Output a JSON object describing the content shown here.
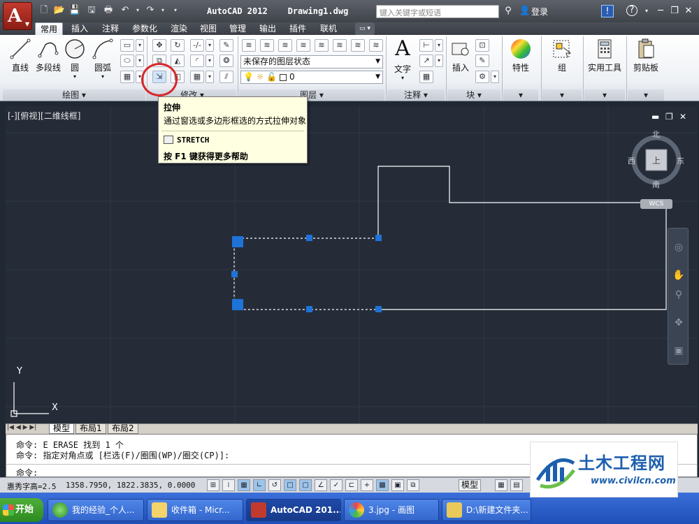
{
  "titlebar": {
    "title": "AutoCAD 2012    Drawing1.dwg",
    "search_placeholder": "键入关键字或短语",
    "login": "登录"
  },
  "tabs": [
    "常用",
    "插入",
    "注释",
    "参数化",
    "渲染",
    "视图",
    "管理",
    "输出",
    "插件",
    "联机"
  ],
  "ribbon": {
    "draw": {
      "line": "直线",
      "polyline": "多段线",
      "circle": "圆",
      "arc": "圆弧",
      "panel": "绘图"
    },
    "modify": {
      "panel": "修改"
    },
    "layers": {
      "state": "未保存的图层状态",
      "current": "0",
      "panel": "图层"
    },
    "annotation": {
      "text": "文字",
      "panel": "注释"
    },
    "block": {
      "insert": "插入",
      "panel": "块"
    },
    "properties": {
      "label": "特性"
    },
    "groups": {
      "label": "组"
    },
    "utilities": {
      "label": "实用工具"
    },
    "clipboard": {
      "label": "剪贴板"
    }
  },
  "tooltip": {
    "title": "拉伸",
    "description": "通过窗选或多边形框选的方式拉伸对象",
    "command": "STRETCH",
    "help": "按 F1 键获得更多帮助"
  },
  "viewport": {
    "label": "[-][俯视][二维线框]",
    "compass": {
      "north": "北",
      "south": "南",
      "east": "东",
      "west": "西",
      "top": "上",
      "wcs": "WCS"
    },
    "ucs": {
      "x": "X",
      "y": "Y"
    }
  },
  "layout_tabs": [
    "模型",
    "布局1",
    "布局2"
  ],
  "command_line": {
    "line1": "命令: E ERASE 找到 1 个",
    "line2": "命令: 指定对角点或 [栏选(F)/圈围(WP)/圈交(CP)]:",
    "prompt": "命令:"
  },
  "status": {
    "text_height": "惠秀字高=2.5",
    "coords": "1358.7950, 1822.3835, 0.0000",
    "model": "模型"
  },
  "taskbar": {
    "start": "开始",
    "tasks": [
      "我的经验_个人...",
      "收件箱 - Micr...",
      "AutoCAD 201...",
      "3.jpg - 画图",
      "D:\\新建文件夹..."
    ]
  },
  "watermark": {
    "main": "土木工程网",
    "url": "www.civilcn.com"
  }
}
